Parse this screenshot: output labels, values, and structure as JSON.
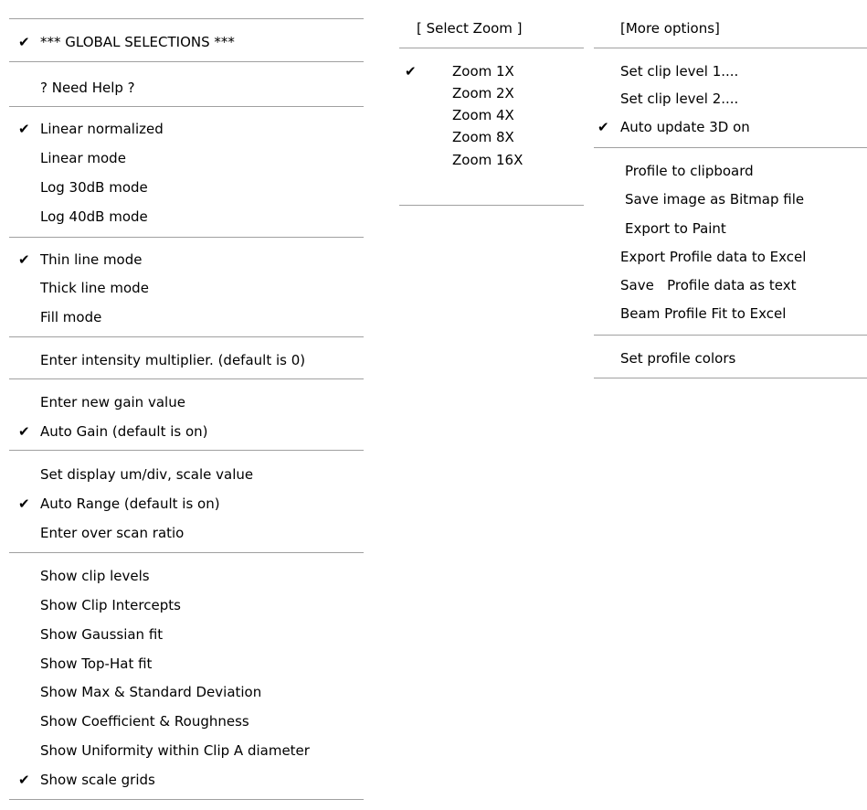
{
  "left_menu": {
    "global_selections": "*** GLOBAL SELECTIONS ***",
    "need_help": "? Need Help ?",
    "display_mode": [
      "Linear normalized",
      "Linear mode",
      "Log 30dB mode",
      "Log 40dB mode"
    ],
    "line_mode": [
      "Thin  line mode",
      "Thick line mode",
      "Fill mode"
    ],
    "intensity": "Enter intensity multiplier. (default is 0)",
    "gain": [
      "Enter new gain value",
      "Auto Gain (default is on)"
    ],
    "range": [
      "Set display um/div, scale value",
      "Auto Range (default is on)",
      "Enter over scan ratio"
    ],
    "show": [
      "Show clip levels",
      "Show Clip Intercepts",
      "Show Gaussian fit",
      "Show Top-Hat fit",
      "Show Max & Standard Deviation",
      "Show Coefficient & Roughness",
      "Show Uniformity within Clip A diameter",
      "Show scale grids"
    ]
  },
  "zoom_menu": {
    "header": "[ Select Zoom ]",
    "items": [
      "Zoom 1X",
      "Zoom 2X",
      "Zoom 4X",
      "Zoom 8X",
      "Zoom 16X"
    ]
  },
  "more_menu": {
    "header": "[More options]",
    "clip": [
      "Set clip level 1....",
      "Set clip level 2....",
      "Auto update 3D on"
    ],
    "export": [
      "Profile to clipboard",
      "Save image as Bitmap file",
      "Export to Paint",
      "Export Profile data to Excel",
      "Save   Profile data as text",
      "Beam Profile Fit to Excel"
    ],
    "colors": "Set profile colors"
  },
  "checkmark": "✔"
}
